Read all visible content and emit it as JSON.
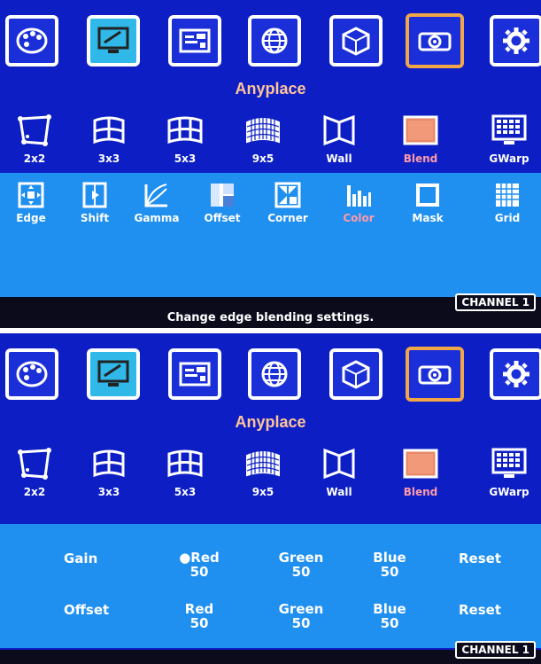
{
  "top_icons": [
    {
      "name": "palette-icon"
    },
    {
      "name": "monitor-tools-icon"
    },
    {
      "name": "layout-icon"
    },
    {
      "name": "globe-icon"
    },
    {
      "name": "cube-icon"
    },
    {
      "name": "projector-icon",
      "selected": true
    },
    {
      "name": "gear-icon"
    }
  ],
  "section_title": "Anyplace",
  "modes": [
    {
      "label": "2x2",
      "icon": "quad-warp-icon"
    },
    {
      "label": "3x3",
      "icon": "curved-3x3-icon"
    },
    {
      "label": "5x3",
      "icon": "curved-5x3-icon"
    },
    {
      "label": "9x5",
      "icon": "curved-9x5-icon"
    },
    {
      "label": "Wall",
      "icon": "wall-icon"
    },
    {
      "label": "Blend",
      "icon": "blend-icon",
      "active": true
    },
    {
      "label": "GWarp",
      "icon": "gwarp-icon"
    }
  ],
  "blend_submenu": [
    {
      "label": "Edge",
      "icon": "edge-icon"
    },
    {
      "label": "Shift",
      "icon": "shift-icon"
    },
    {
      "label": "Gamma",
      "icon": "gamma-icon"
    },
    {
      "label": "Offset",
      "icon": "offset-icon"
    },
    {
      "label": "Corner",
      "icon": "corner-icon"
    },
    {
      "label": "Color",
      "icon": "color-bars-icon",
      "active": true
    },
    {
      "label": "Mask",
      "icon": "mask-icon"
    },
    {
      "label": "Grid",
      "icon": "grid-icon"
    }
  ],
  "status_text": "Change edge blending settings.",
  "channel_label": "CHANNEL 1",
  "color_settings": {
    "gain": {
      "label": "Gain",
      "red": {
        "name": "●Red",
        "value": "50"
      },
      "green": {
        "name": "Green",
        "value": "50"
      },
      "blue": {
        "name": "Blue",
        "value": "50"
      },
      "reset": "Reset"
    },
    "offset": {
      "label": "Offset",
      "red": {
        "name": "Red",
        "value": "50"
      },
      "green": {
        "name": "Green",
        "value": "50"
      },
      "blue": {
        "name": "Blue",
        "value": "50"
      },
      "reset": "Reset"
    }
  },
  "colors": {
    "osd_bg": "#0d1fc4",
    "panel_bg": "#1f8ff0",
    "selected_border": "#f2a64a",
    "title": "#ffc49a",
    "active_label": "#ff9aa8"
  }
}
